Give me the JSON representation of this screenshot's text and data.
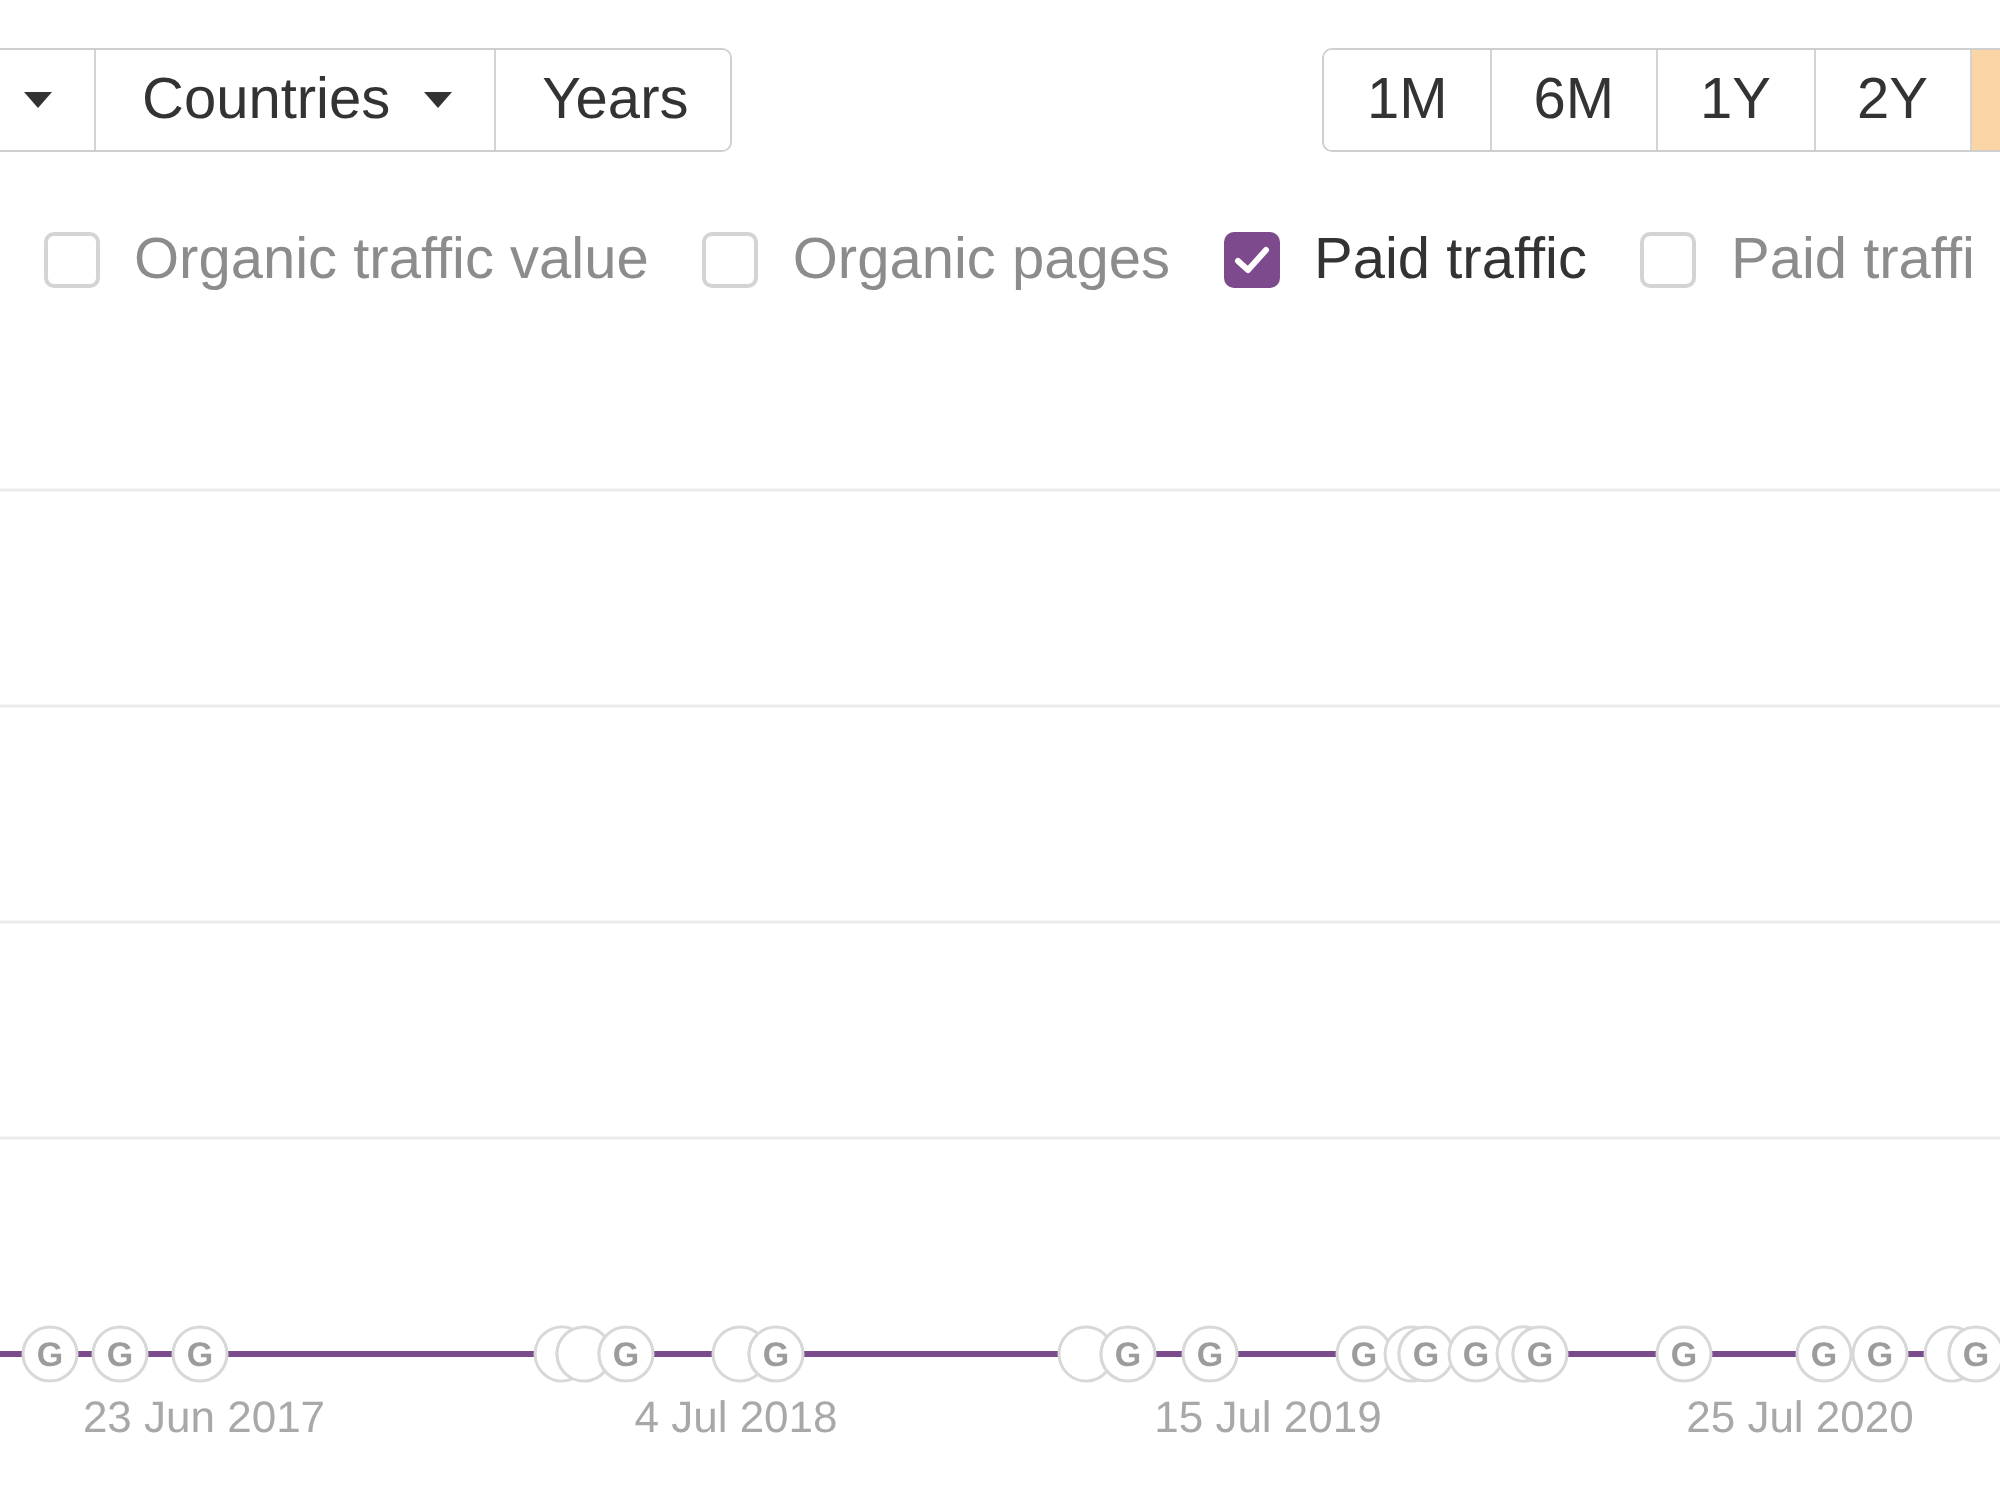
{
  "filter_bar": {
    "filters": [
      {
        "kind": "dropdown"
      },
      {
        "kind": "dropdown",
        "label": "Countries"
      },
      {
        "kind": "button",
        "label": "Years"
      }
    ]
  },
  "range_buttons": [
    {
      "label": "1M",
      "selected": false
    },
    {
      "label": "6M",
      "selected": false
    },
    {
      "label": "1Y",
      "selected": false
    },
    {
      "label": "2Y",
      "selected": false
    },
    {
      "selected": true
    }
  ],
  "series_toggles": [
    {
      "label": "Organic traffic value",
      "checked": false
    },
    {
      "label": "Organic pages",
      "checked": false
    },
    {
      "label": "Paid traffic",
      "checked": true
    },
    {
      "label": "Paid traffi",
      "checked": false
    }
  ],
  "chart": {
    "x_labels": [
      "23 Jun 2017",
      "4 Jul 2018",
      "15 Jul 2019",
      "25 Jul 2020"
    ],
    "update_markers": [
      {
        "kind": "labeled",
        "label": "G"
      },
      {
        "kind": "labeled",
        "label": "G"
      },
      {
        "kind": "labeled",
        "label": "G"
      },
      {
        "kind": "covered"
      },
      {
        "kind": "covered"
      },
      {
        "kind": "labeled",
        "label": "G"
      },
      {
        "kind": "covered"
      },
      {
        "kind": "labeled",
        "label": "G"
      },
      {
        "kind": "covered"
      },
      {
        "kind": "labeled",
        "label": "G"
      },
      {
        "kind": "labeled",
        "label": "G"
      },
      {
        "kind": "labeled",
        "label": "G"
      },
      {
        "kind": "covered"
      },
      {
        "kind": "labeled",
        "label": "G"
      },
      {
        "kind": "labeled",
        "label": "G"
      },
      {
        "kind": "covered"
      },
      {
        "kind": "labeled",
        "label": "G"
      },
      {
        "kind": "labeled",
        "label": "G"
      },
      {
        "kind": "labeled",
        "label": "G"
      },
      {
        "kind": "labeled",
        "label": "G"
      },
      {
        "kind": "covered"
      },
      {
        "kind": "labeled",
        "label": "G"
      }
    ]
  }
}
